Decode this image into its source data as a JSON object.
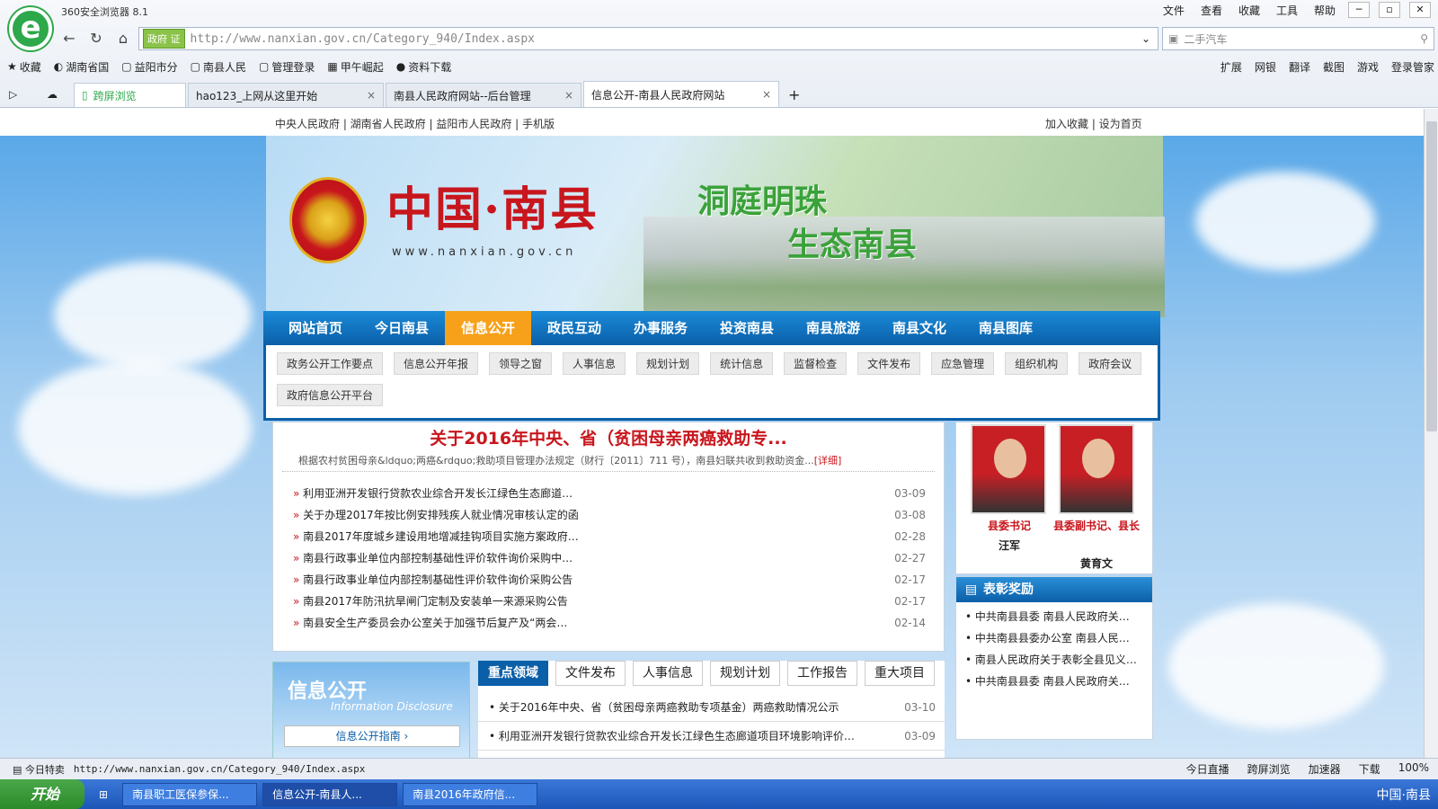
{
  "browser": {
    "title": "360安全浏览器 8.1",
    "menu": [
      "文件",
      "查看",
      "收藏",
      "工具",
      "帮助"
    ],
    "gov_tag": "政府 证",
    "url": "http://www.nanxian.gov.cn/Category_940/Index.aspx",
    "search_text": "二手汽车",
    "favorites": [
      "收藏",
      "湖南省国",
      "益阳市分",
      "南县人民",
      "管理登录",
      "甲午崛起",
      "资料下载"
    ],
    "favorites_right": [
      "扩展",
      "网银",
      "翻译",
      "截图",
      "游戏",
      "登录管家"
    ],
    "tabs": [
      {
        "label": "跨屏浏览"
      },
      {
        "label": "hao123_上网从这里开始"
      },
      {
        "label": "南县人民政府网站--后台管理"
      },
      {
        "label": "信息公开-南县人民政府网站"
      }
    ]
  },
  "page": {
    "top_links_left": "中央人民政府 | 湖南省人民政府 | 益阳市人民政府 | 手机版",
    "top_links_right": "加入收藏 | 设为首页",
    "banner_title": "中国·南县",
    "banner_url": "www.nanxian.gov.cn",
    "slogan1": "洞庭明珠",
    "slogan2": "生态南县",
    "nav": [
      "网站首页",
      "今日南县",
      "信息公开",
      "政民互动",
      "办事服务",
      "投资南县",
      "南县旅游",
      "南县文化",
      "南县图库"
    ],
    "subnav": [
      "政务公开工作要点",
      "信息公开年报",
      "领导之窗",
      "人事信息",
      "规划计划",
      "统计信息",
      "监督检查",
      "文件发布",
      "应急管理",
      "组织机构",
      "政府会议",
      "政府信息公开平台"
    ],
    "headline": "关于2016年中央、省（贫困母亲两癌救助专...",
    "summary": "根据农村贫困母亲&ldquo;两癌&rdquo;救助项目管理办法规定（财行〔2011〕711 号），南县妇联共收到救助资金...",
    "summary_more": "[详细]",
    "news": [
      {
        "title": "利用亚洲开发银行贷款农业综合开发长江绿色生态廊道…",
        "date": "03-09"
      },
      {
        "title": "关于办理2017年按比例安排残疾人就业情况审核认定的函",
        "date": "03-08"
      },
      {
        "title": "南县2017年度城乡建设用地增减挂钩项目实施方案政府…",
        "date": "02-28"
      },
      {
        "title": "南县行政事业单位内部控制基础性评价软件询价采购中…",
        "date": "02-27"
      },
      {
        "title": "南县行政事业单位内部控制基础性评价软件询价采购公告",
        "date": "02-17"
      },
      {
        "title": "南县2017年防汛抗旱闸门定制及安装单一来源采购公告",
        "date": "02-17"
      },
      {
        "title": "南县安全生产委员会办公室关于加强节后复产及“两会…",
        "date": "02-14"
      }
    ],
    "leaders": [
      {
        "title": "县委书记",
        "name": "汪军"
      },
      {
        "title": "县委副书记、县长",
        "name": "黄育文"
      }
    ],
    "award_title": "表彰奖励",
    "awards": [
      "中共南县县委  南县人民政府关…",
      "中共南县县委办公室  南县人民…",
      "南县人民政府关于表彰全县见义…",
      "中共南县县委  南县人民政府关…"
    ],
    "info_title": "信息公开",
    "info_sub": "Information Disclosure",
    "info_guide": "信息公开指南",
    "tabs": [
      "重点领域",
      "文件发布",
      "人事信息",
      "规划计划",
      "工作报告",
      "重大项目"
    ],
    "tab_items": [
      {
        "title": "关于2016年中央、省（贫困母亲两癌救助专项基金）两癌救助情况公示",
        "date": "03-10"
      },
      {
        "title": "利用亚洲开发银行贷款农业综合开发长江绿色生态廊道项目环境影响评价…",
        "date": "03-09"
      }
    ]
  },
  "status": {
    "left": "今日特卖",
    "url": "http://www.nanxian.gov.cn/Category_940/Index.aspx",
    "right": [
      "今日直播",
      "跨屏浏览",
      "加速器",
      "下载",
      "100%"
    ]
  },
  "taskbar": {
    "start": "开始",
    "tasks": [
      "南县职工医保参保...",
      "信息公开-南县人...",
      "南县2016年政府信..."
    ],
    "tray": "中国·南县"
  }
}
